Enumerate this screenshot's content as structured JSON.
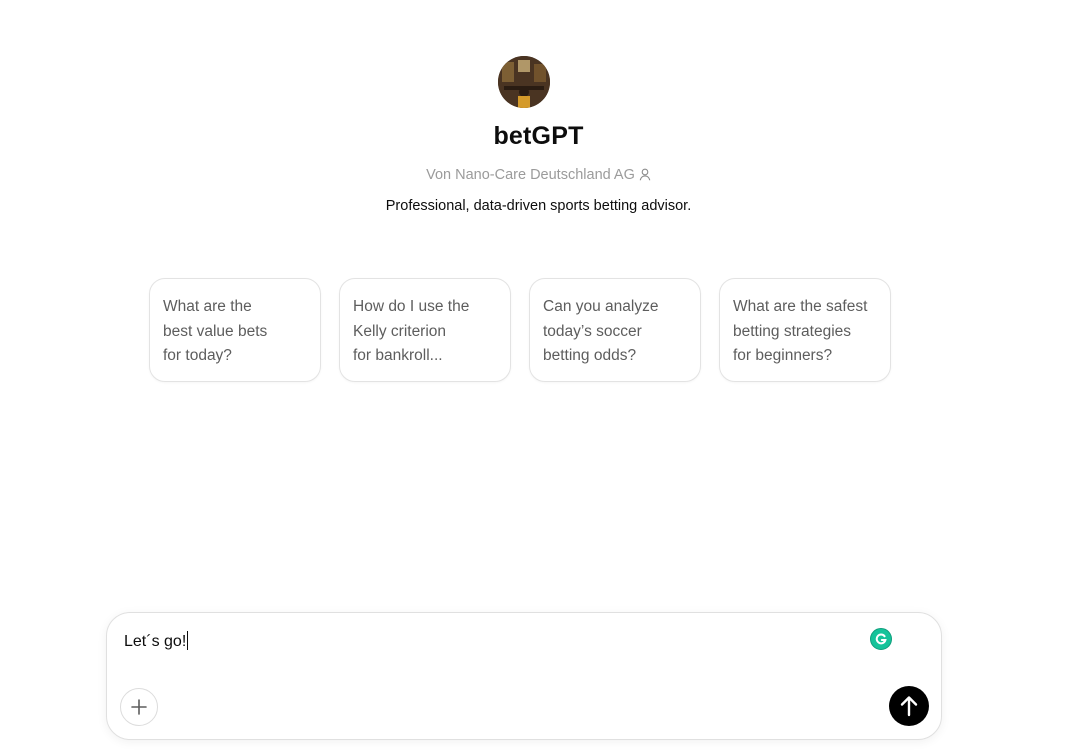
{
  "gpt": {
    "name": "betGPT",
    "author": "Von Nano-Care Deutschland AG",
    "description": "Professional, data-driven sports betting advisor."
  },
  "conversation_starters": [
    {
      "line1": "What are the",
      "line2": "best value bets",
      "line3": "for today?"
    },
    {
      "line1": "How do I use the",
      "line2": "Kelly criterion",
      "line3": "for bankroll..."
    },
    {
      "line1": "Can you analyze",
      "line2": "today’s soccer",
      "line3": "betting odds?"
    },
    {
      "line1": "What are the safest",
      "line2": "betting strategies",
      "line3": "for beginners?"
    }
  ],
  "composer": {
    "value": "Let´s go!"
  },
  "icons": {
    "author": "person-icon",
    "grammarly": "grammarly-icon",
    "attach": "plus-icon",
    "send": "arrow-up-icon"
  },
  "colors": {
    "send_button": "#000000",
    "grammarly": "#15c39a",
    "muted_text": "#9b9b9b"
  }
}
